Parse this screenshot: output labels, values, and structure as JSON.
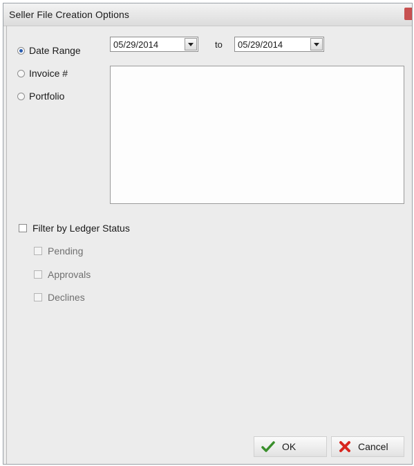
{
  "dialog": {
    "title": "Seller File Creation Options"
  },
  "options": {
    "date_range": {
      "label": "Date Range",
      "selected": true
    },
    "invoice": {
      "label": "Invoice #",
      "selected": false
    },
    "portfolio": {
      "label": "Portfolio",
      "selected": false
    }
  },
  "dates": {
    "from": "05/29/2014",
    "to_label": "to",
    "to": "05/29/2014"
  },
  "filter": {
    "label": "Filter by Ledger Status",
    "checked": false,
    "items": [
      {
        "label": "Pending",
        "checked": false,
        "enabled": false
      },
      {
        "label": "Approvals",
        "checked": false,
        "enabled": false
      },
      {
        "label": "Declines",
        "checked": false,
        "enabled": false
      }
    ]
  },
  "buttons": {
    "ok_label": "OK",
    "cancel_label": "Cancel"
  },
  "icons": {
    "ok": "checkmark-icon",
    "cancel": "x-icon",
    "dropdown": "chevron-down-icon"
  },
  "colors": {
    "ok_icon": "#3a8f2c",
    "cancel_icon": "#d8261f",
    "radio_dot": "#2a5db0"
  }
}
